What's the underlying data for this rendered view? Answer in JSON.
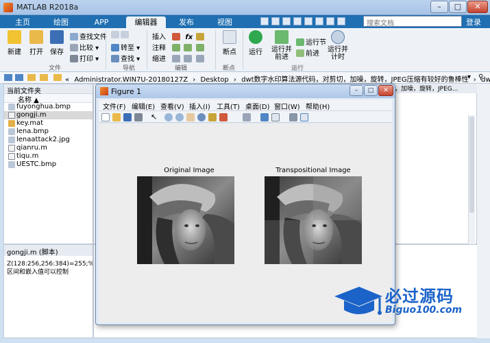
{
  "app": {
    "title": "MATLAB R2018a"
  },
  "window_controls": [
    "–",
    "□",
    "✕"
  ],
  "tabs": [
    {
      "label": "主页"
    },
    {
      "label": "绘图"
    },
    {
      "label": "APP"
    },
    {
      "label": "编辑器"
    },
    {
      "label": "发布"
    },
    {
      "label": "视图"
    }
  ],
  "search": {
    "placeholder": "搜索文档"
  },
  "login_label": "登录",
  "ribbon": {
    "file": {
      "new": "新建",
      "open": "打开",
      "save": "保存",
      "find_files": "查找文件",
      "compare": "比较",
      "print": "打印",
      "group": "文件"
    },
    "navigate": {
      "goto": "转至",
      "find": "查找",
      "group": "导航"
    },
    "edit": {
      "insert": "插入",
      "comment": "注释",
      "indent": "缩进",
      "fx": "fx",
      "group": "编辑"
    },
    "breakpoints": {
      "breakpoints": "断点",
      "group": "断点"
    },
    "run": {
      "run": "运行",
      "run_advance": "运行并\n前进",
      "run_section": "运行节",
      "advance": "前进",
      "run_time": "运行并\n计时",
      "group": "运行"
    }
  },
  "address": {
    "parts": [
      "«",
      "Administrator.WIN7U-20180127Z",
      "›",
      "Desktop",
      "›",
      "dwt数字水印算法源代码，对剪切，加噪，旋转，JPEG压缩有较好的鲁棒性",
      "›",
      "dwt"
    ]
  },
  "current_folder": {
    "header": "当前文件夹",
    "name_column": "名称 ▲",
    "files": [
      {
        "name": "fuyonghua.bmp",
        "type": "bmp"
      },
      {
        "name": "gongji.m",
        "type": "m",
        "selected": true
      },
      {
        "name": "key.mat",
        "type": "mat"
      },
      {
        "name": "lena.bmp",
        "type": "bmp"
      },
      {
        "name": "lenaattack2.jpg",
        "type": "jpg"
      },
      {
        "name": "qianru.m",
        "type": "m"
      },
      {
        "name": "tiqu.m",
        "type": "m"
      },
      {
        "name": "UESTC.bmp",
        "type": "bmp"
      }
    ]
  },
  "details": {
    "title": "gongji.m  (脚本)",
    "lines": [
      "Z(128:256,256:384)=255;%剪",
      "区间和嵌入值可以控制"
    ]
  },
  "editor_tab_text": "，加噪，旋转，JPEG...",
  "figure": {
    "title": "Figure 1",
    "menus": [
      "文件(F)",
      "编辑(E)",
      "查看(V)",
      "插入(I)",
      "工具(T)",
      "桌面(D)",
      "窗口(W)",
      "帮助(H)"
    ],
    "axes": [
      {
        "title": "Original Image"
      },
      {
        "title": "Transpositional Image"
      }
    ]
  },
  "watermark": {
    "main": "必过源码",
    "site": "Biguo100.com"
  },
  "colors": {
    "ribbon_blue": "#1f6fb2",
    "accent": "#1b63c9",
    "figure_bg": "#ededed"
  }
}
